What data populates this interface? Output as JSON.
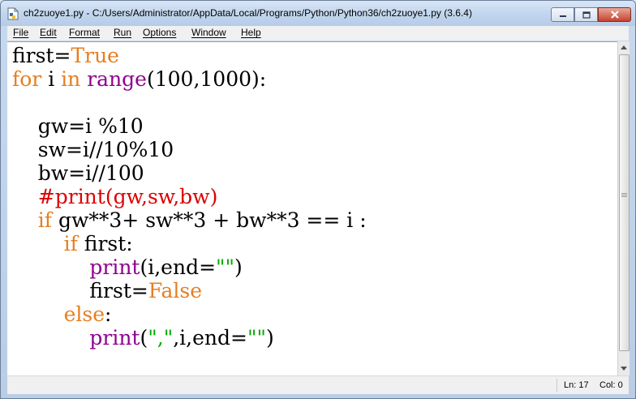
{
  "window": {
    "title": "ch2zuoye1.py - C:/Users/Administrator/AppData/Local/Programs/Python/Python36/ch2zuoye1.py (3.6.4)"
  },
  "menu": {
    "items": [
      "File",
      "Edit",
      "Format",
      "Run",
      "Options",
      "Window",
      "Help"
    ]
  },
  "editor": {
    "lines": [
      [
        {
          "t": "first=",
          "c": "blk"
        },
        {
          "t": "True",
          "c": "kw"
        }
      ],
      [
        {
          "t": "for",
          "c": "kw"
        },
        {
          "t": " i ",
          "c": "blk"
        },
        {
          "t": "in",
          "c": "kw"
        },
        {
          "t": " ",
          "c": "blk"
        },
        {
          "t": "range",
          "c": "bi"
        },
        {
          "t": "(100,1000):",
          "c": "blk"
        }
      ],
      [],
      [
        {
          "t": "    gw=i %10",
          "c": "blk"
        }
      ],
      [
        {
          "t": "    sw=i//10%10",
          "c": "blk"
        }
      ],
      [
        {
          "t": "    bw=i//100",
          "c": "blk"
        }
      ],
      [
        {
          "t": "    #print(gw,sw,bw)",
          "c": "cmt"
        }
      ],
      [
        {
          "t": "    ",
          "c": "blk"
        },
        {
          "t": "if",
          "c": "kw"
        },
        {
          "t": " gw**3+ sw**3 + bw**3 == i :",
          "c": "blk"
        }
      ],
      [
        {
          "t": "        ",
          "c": "blk"
        },
        {
          "t": "if",
          "c": "kw"
        },
        {
          "t": " first:",
          "c": "blk"
        }
      ],
      [
        {
          "t": "            ",
          "c": "blk"
        },
        {
          "t": "print",
          "c": "bi"
        },
        {
          "t": "(i,end=",
          "c": "blk"
        },
        {
          "t": "\"\"",
          "c": "str"
        },
        {
          "t": ")",
          "c": "blk"
        }
      ],
      [
        {
          "t": "            first=",
          "c": "blk"
        },
        {
          "t": "False",
          "c": "kw"
        }
      ],
      [
        {
          "t": "        ",
          "c": "blk"
        },
        {
          "t": "else",
          "c": "kw"
        },
        {
          "t": ":",
          "c": "blk"
        }
      ],
      [
        {
          "t": "            ",
          "c": "blk"
        },
        {
          "t": "print",
          "c": "bi"
        },
        {
          "t": "(",
          "c": "blk"
        },
        {
          "t": "\",\"",
          "c": "str"
        },
        {
          "t": ",i,end=",
          "c": "blk"
        },
        {
          "t": "\"\"",
          "c": "str"
        },
        {
          "t": ")",
          "c": "blk"
        }
      ]
    ]
  },
  "status": {
    "line": "Ln: 17",
    "col": "Col: 0"
  },
  "icons": [
    "python-file-icon",
    "minimize-icon",
    "maximize-icon",
    "close-icon",
    "scroll-up-icon",
    "scroll-down-icon"
  ]
}
